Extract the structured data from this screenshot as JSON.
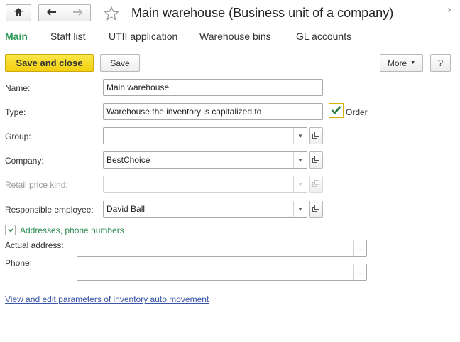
{
  "window": {
    "title": "Main warehouse (Business unit of a company)",
    "close_symbol": "×"
  },
  "tabs": [
    {
      "label": "Main",
      "active": true
    },
    {
      "label": "Staff list"
    },
    {
      "label": "UTII application"
    },
    {
      "label": "Warehouse bins"
    },
    {
      "label": "GL accounts"
    }
  ],
  "toolbar": {
    "save_close_label": "Save and close",
    "save_label": "Save",
    "more_label": "More",
    "help_label": "?"
  },
  "form": {
    "name": {
      "label": "Name:",
      "value": "Main warehouse"
    },
    "type": {
      "label": "Type:",
      "value": "Warehouse the inventory is capitalized to",
      "checkbox_label": "Order",
      "checkbox_checked": true
    },
    "group": {
      "label": "Group:",
      "value": ""
    },
    "company": {
      "label": "Company:",
      "value": "BestChoice"
    },
    "retail_price_kind": {
      "label": "Retail price kind:",
      "value": "",
      "disabled": true
    },
    "responsible_employee": {
      "label": "Responsible employee:",
      "value": "David Ball"
    }
  },
  "addresses": {
    "title": "Addresses, phone numbers",
    "actual_address": {
      "label": "Actual address:",
      "value": ""
    },
    "phone": {
      "label": "Phone:",
      "value": ""
    },
    "choice_symbol": "..."
  },
  "link_text": "View and edit parameters of inventory auto movement",
  "colors": {
    "accent": "#2c9b57",
    "primary_button": "#f5d51f",
    "link": "#3b55a8"
  }
}
